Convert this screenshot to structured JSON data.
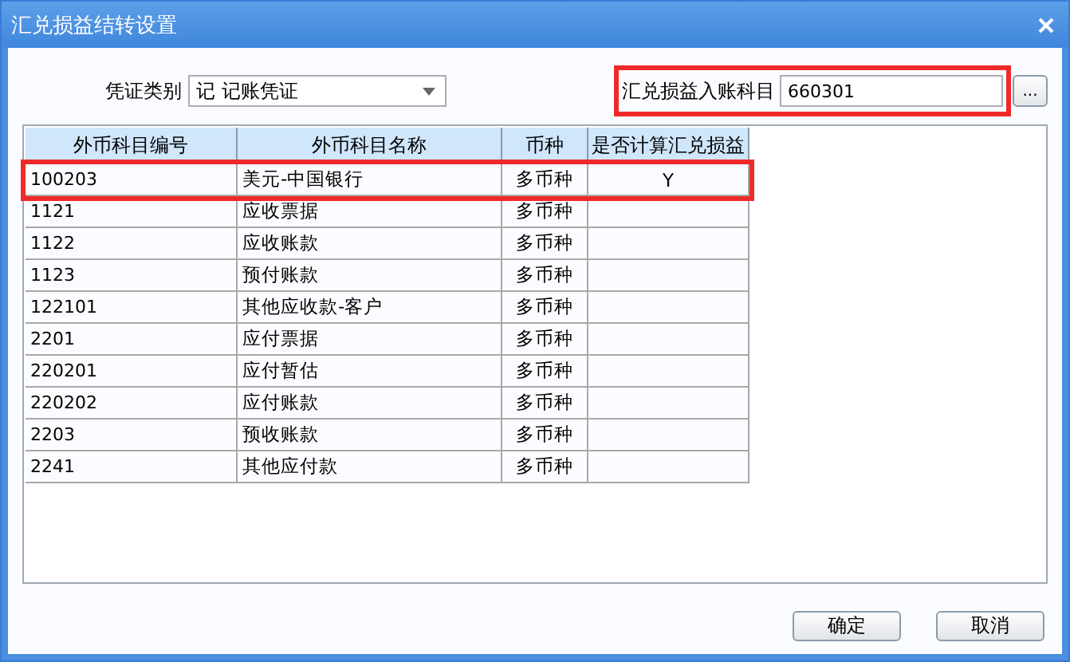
{
  "window": {
    "title": "汇兑损益结转设置"
  },
  "voucher_type": {
    "label": "凭证类别",
    "value": "记  记账凭证"
  },
  "account_field": {
    "label": "汇兑损益入账科目",
    "value": "660301",
    "highlighted": true,
    "browse_button": "..."
  },
  "table": {
    "columns": [
      "外币科目编号",
      "外币科目名称",
      "币种",
      "是否计算汇兑损益"
    ],
    "rows": [
      {
        "cells": [
          "100203",
          "美元-中国银行",
          "多币种",
          "Y"
        ],
        "highlighted": true
      },
      {
        "cells": [
          "1121",
          "应收票据",
          "多币种",
          ""
        ],
        "highlighted": false
      },
      {
        "cells": [
          "1122",
          "应收账款",
          "多币种",
          ""
        ],
        "highlighted": false
      },
      {
        "cells": [
          "1123",
          "预付账款",
          "多币种",
          ""
        ],
        "highlighted": false
      },
      {
        "cells": [
          "122101",
          "其他应收款-客户",
          "多币种",
          ""
        ],
        "highlighted": false
      },
      {
        "cells": [
          "2201",
          "应付票据",
          "多币种",
          ""
        ],
        "highlighted": false
      },
      {
        "cells": [
          "220201",
          "应付暂估",
          "多币种",
          ""
        ],
        "highlighted": false
      },
      {
        "cells": [
          "220202",
          "应付账款",
          "多币种",
          ""
        ],
        "highlighted": false
      },
      {
        "cells": [
          "2203",
          "预收账款",
          "多币种",
          ""
        ],
        "highlighted": false
      },
      {
        "cells": [
          "2241",
          "其他应付款",
          "多币种",
          ""
        ],
        "highlighted": false
      }
    ]
  },
  "buttons": [
    "确定",
    "取消"
  ]
}
